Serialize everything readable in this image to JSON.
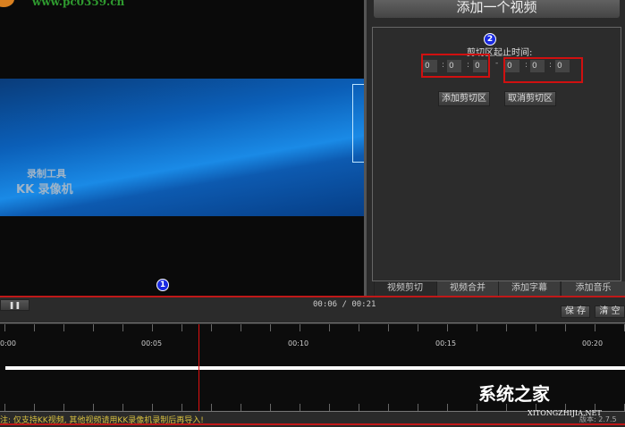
{
  "video": {
    "url_watermark": "www.pc0359.cn",
    "watermark_line1": "录制工具",
    "watermark_line2": "KK 录像机",
    "badge1": "1"
  },
  "side": {
    "add_video": "添加一个视频",
    "badge2": "2",
    "cut_label": "剪切区起止时间:",
    "start": [
      "0",
      "0",
      "0"
    ],
    "end": [
      "0",
      "0",
      "0"
    ],
    "dash": "-",
    "colon": ":",
    "add_cut": "添加剪切区",
    "cancel_cut": "取消剪切区"
  },
  "tabs": [
    "视频剪切",
    "视频合并",
    "添加字幕",
    "添加音乐"
  ],
  "controls": {
    "pause": "❚❚",
    "time": "00:06 / 00:21",
    "save": "保 存",
    "clear": "清 空"
  },
  "timeline": {
    "labels": [
      "0:00",
      "00:05",
      "00:10",
      "00:15",
      "00:20"
    ],
    "playhead_seconds": 6,
    "duration_seconds": 21
  },
  "status": {
    "note": "注: 仅支持KK视频, 其他视频请用KK录像机录制后再导入!",
    "version": "版本: 2.7.5"
  },
  "site_watermark": {
    "name": "系统之家",
    "domain": "XITONGZHIJIA.NET"
  }
}
